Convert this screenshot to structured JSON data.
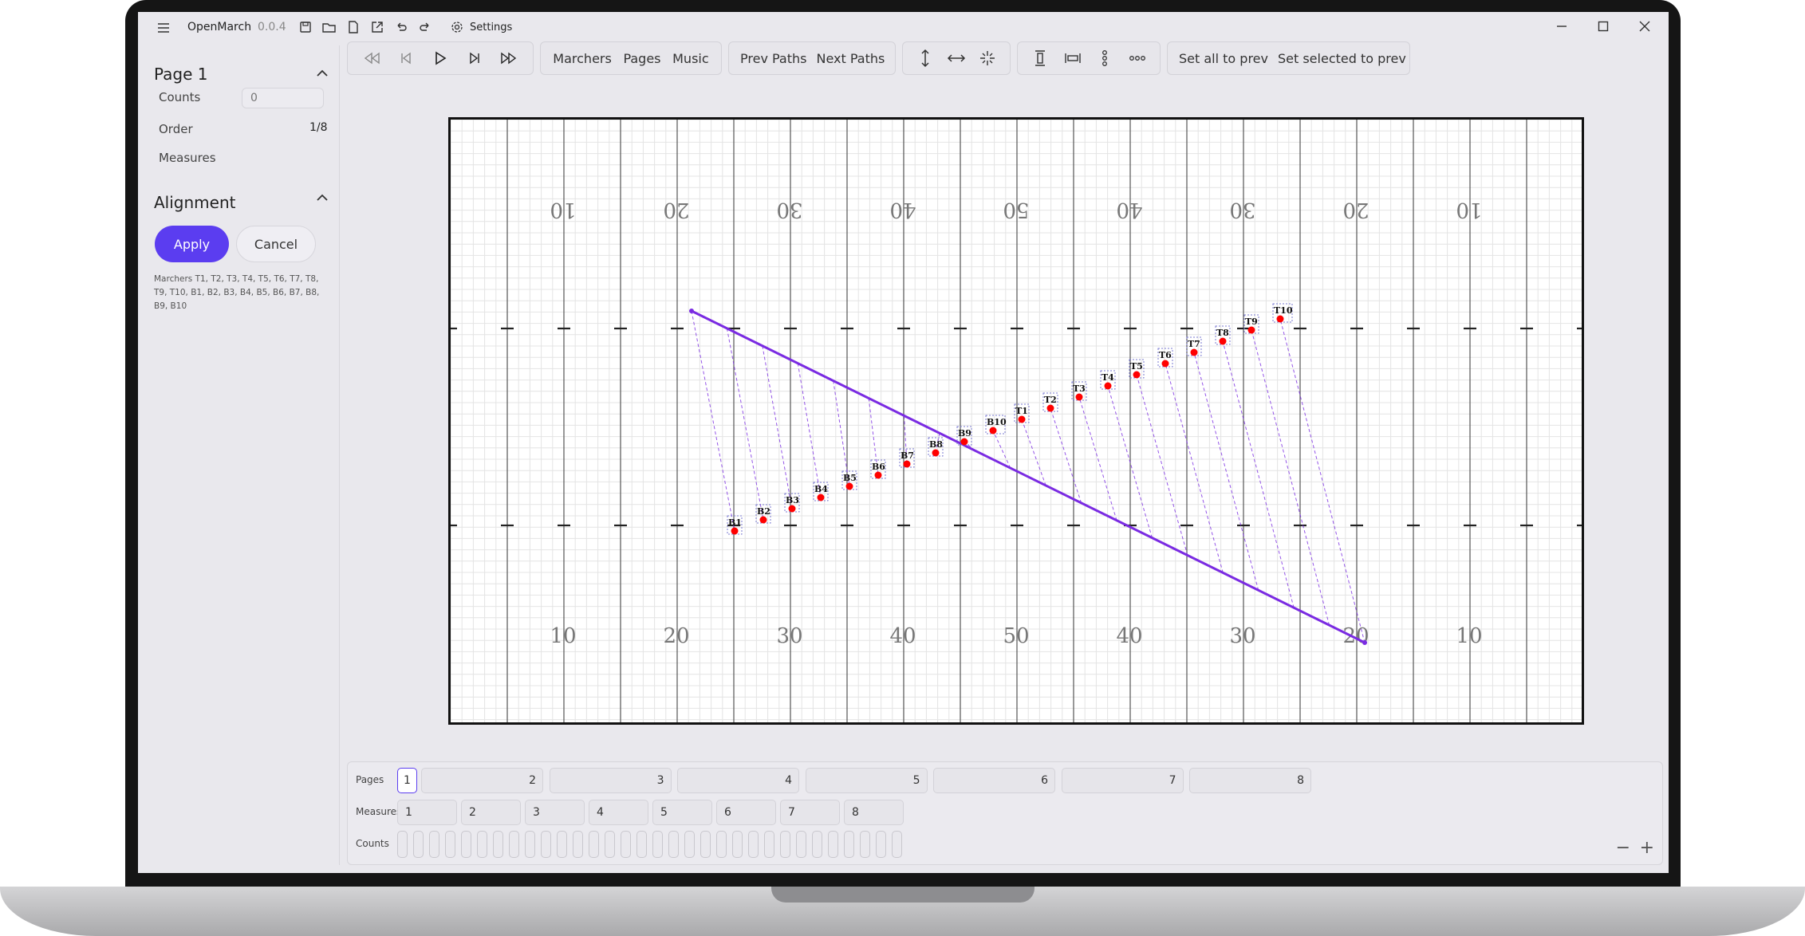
{
  "app": {
    "name": "OpenMarch",
    "version": "0.0.4",
    "settings_label": "Settings"
  },
  "titlebar_icons": [
    "menu-icon",
    "save-icon",
    "open-folder-icon",
    "new-file-icon",
    "export-icon",
    "undo-icon",
    "redo-icon"
  ],
  "window_controls": {
    "minimize": "—",
    "maximize": "☐",
    "close": "✕"
  },
  "sidebar": {
    "page_section": {
      "title": "Page 1",
      "counts_label": "Counts",
      "counts_placeholder": "0",
      "order_label": "Order",
      "order_value": "1/8",
      "measures_label": "Measures"
    },
    "alignment_section": {
      "title": "Alignment",
      "apply_label": "Apply",
      "cancel_label": "Cancel",
      "marchers_text": "Marchers T1, T2, T3, T4, T5, T6, T7, T8, T9, T10, B1, B2, B3, B4, B5, B6, B7, B8, B9, B10"
    }
  },
  "toolbar": {
    "playback": [
      "rewind-icon",
      "previous-icon",
      "play-icon",
      "next-icon",
      "fast-forward-icon"
    ],
    "views": {
      "marchers": "Marchers",
      "pages": "Pages",
      "music": "Music"
    },
    "paths": {
      "prev": "Prev Paths",
      "next": "Next Paths"
    },
    "align_icons": [
      "align-vertical-icon",
      "align-horizontal-icon",
      "evenly-distribute-icon"
    ],
    "distribute_icons": [
      "distribute-vertical-icon",
      "distribute-horizontal-icon",
      "vertical-dots-icon",
      "horizontal-dots-icon"
    ],
    "set_all_prev": "Set all to prev",
    "set_selected_prev": "Set selected to prev"
  },
  "field": {
    "yard_numbers": [
      "10",
      "20",
      "30",
      "40",
      "50",
      "40",
      "30",
      "20",
      "10"
    ],
    "marchers": [
      {
        "label": "B1"
      },
      {
        "label": "B2"
      },
      {
        "label": "B3"
      },
      {
        "label": "B4"
      },
      {
        "label": "B5"
      },
      {
        "label": "B6"
      },
      {
        "label": "B7"
      },
      {
        "label": "B8"
      },
      {
        "label": "B9"
      },
      {
        "label": "B10"
      },
      {
        "label": "T1"
      },
      {
        "label": "T2"
      },
      {
        "label": "T3"
      },
      {
        "label": "T4"
      },
      {
        "label": "T5"
      },
      {
        "label": "T6"
      },
      {
        "label": "T7"
      },
      {
        "label": "T8"
      },
      {
        "label": "T9"
      },
      {
        "label": "T10"
      }
    ],
    "line_color": "#7a2be2",
    "dot_color": "#ff0000"
  },
  "timeline": {
    "pages_label": "Pages",
    "measures_label": "Measures",
    "counts_label": "Counts",
    "pages": [
      "1",
      "2",
      "3",
      "4",
      "5",
      "6",
      "7",
      "8"
    ],
    "measures": [
      "1",
      "2",
      "3",
      "4",
      "5",
      "6",
      "7",
      "8"
    ],
    "count_boxes": 32,
    "zoom_out": "−",
    "zoom_in": "+"
  },
  "colors": {
    "accent": "#5b3df0",
    "path": "#7a2be2",
    "marcher": "#ff0000"
  }
}
